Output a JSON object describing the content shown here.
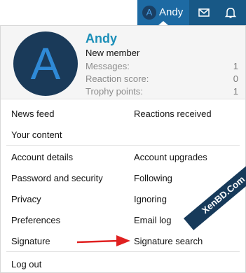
{
  "topbar": {
    "avatar_letter": "A",
    "username": "Andy",
    "icons": [
      "mail-icon",
      "bell-icon"
    ]
  },
  "profile": {
    "avatar_letter": "A",
    "name": "Andy",
    "title": "New member",
    "stats": [
      {
        "label": "Messages:",
        "value": "1"
      },
      {
        "label": "Reaction score:",
        "value": "0"
      },
      {
        "label": "Trophy points:",
        "value": "1"
      }
    ]
  },
  "menu": {
    "news_feed": "News feed",
    "reactions_received": "Reactions received",
    "your_content": "Your content",
    "account_details": "Account details",
    "account_upgrades": "Account upgrades",
    "password_security": "Password and security",
    "following": "Following",
    "privacy": "Privacy",
    "ignoring": "Ignoring",
    "preferences": "Preferences",
    "email_log": "Email log",
    "signature": "Signature",
    "signature_search": "Signature search",
    "log_out": "Log out"
  },
  "watermark": "XenBD.Com",
  "colors": {
    "header_bg": "#185886",
    "active_tab": "#1d6aa3",
    "name_color": "#1c8fb8",
    "avatar_bg": "#1a3a59",
    "avatar_letter": "#2f8ad7",
    "arrow": "#e02020"
  }
}
